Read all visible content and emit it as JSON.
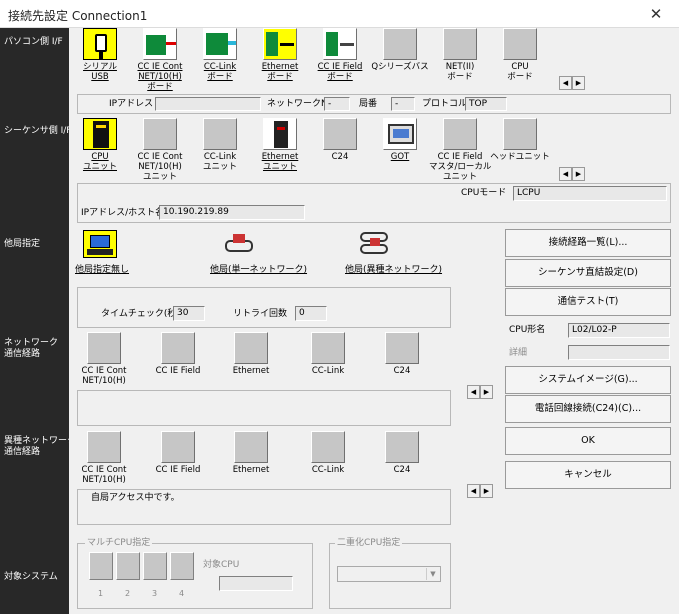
{
  "window": {
    "title": "接続先設定 Connection1",
    "close": "✕"
  },
  "sidebar": {
    "pc_side": "パソコン側 I/F",
    "plc_side": "シーケンサ側 I/F",
    "other_station": "他局指定",
    "network_route_1": "ネットワーク",
    "network_route_2": "通信経路",
    "hetero_route_1": "異種ネットワーク",
    "hetero_route_2": "通信経路",
    "target_system": "対象システム"
  },
  "pc_if": {
    "items": [
      {
        "label1": "シリアル",
        "label2": "USB",
        "label3": ""
      },
      {
        "label1": "CC IE Cont",
        "label2": "NET/10(H)",
        "label3": "ボード"
      },
      {
        "label1": "CC-Link",
        "label2": "ボード",
        "label3": ""
      },
      {
        "label1": "Ethernet",
        "label2": "ボード",
        "label3": ""
      },
      {
        "label1": "CC IE Field",
        "label2": "ボード",
        "label3": ""
      },
      {
        "label1": "Qシリーズバス",
        "label2": "",
        "label3": ""
      },
      {
        "label1": "NET(II)",
        "label2": "ボード",
        "label3": ""
      },
      {
        "label1": "CPU",
        "label2": "ボード",
        "label3": ""
      }
    ],
    "ip_label": "IPアドレス",
    "ip_value": "",
    "network_no_label": "ネットワークNo",
    "network_no_value": "-",
    "station_label": "局番",
    "station_value": "-",
    "protocol_label": "プロトコル",
    "protocol_value": "TOP"
  },
  "plc_if": {
    "items": [
      {
        "label1": "CPU",
        "label2": "ユニット",
        "label3": ""
      },
      {
        "label1": "CC IE Cont",
        "label2": "NET/10(H)",
        "label3": "ユニット"
      },
      {
        "label1": "CC-Link",
        "label2": "ユニット",
        "label3": ""
      },
      {
        "label1": "Ethernet",
        "label2": "ユニット",
        "label3": ""
      },
      {
        "label1": "C24",
        "label2": "",
        "label3": ""
      },
      {
        "label1": "GOT",
        "label2": "",
        "label3": ""
      },
      {
        "label1": "CC IE Field",
        "label2": "マスタ/ローカル",
        "label3": "ユニット"
      },
      {
        "label1": "ヘッドユニット",
        "label2": "",
        "label3": ""
      }
    ],
    "cpu_mode_label": "CPUモード",
    "cpu_mode_value": "LCPU",
    "host_label": "IPアドレス/ホスト名",
    "host_value": "10.190.219.89"
  },
  "other": {
    "no_other": "他局指定無し",
    "single_net": "他局(単一ネットワーク)",
    "multi_net": "他局(異種ネットワーク)",
    "timecheck_label": "タイムチェック(秒)",
    "timecheck_value": "30",
    "retry_label": "リトライ回数",
    "retry_value": "0"
  },
  "route1": {
    "items": [
      {
        "label1": "CC IE Cont",
        "label2": "NET/10(H)"
      },
      {
        "label1": "CC IE Field",
        "label2": ""
      },
      {
        "label1": "Ethernet",
        "label2": ""
      },
      {
        "label1": "CC-Link",
        "label2": ""
      },
      {
        "label1": "C24",
        "label2": ""
      }
    ]
  },
  "route2": {
    "items": [
      {
        "label1": "CC IE Cont",
        "label2": "NET/10(H)"
      },
      {
        "label1": "CC IE Field",
        "label2": ""
      },
      {
        "label1": "Ethernet",
        "label2": ""
      },
      {
        "label1": "CC-Link",
        "label2": ""
      },
      {
        "label1": "C24",
        "label2": ""
      }
    ],
    "status": "自局アクセス中です。"
  },
  "buttons": {
    "route_list": "接続経路一覧(L)...",
    "direct": "シーケンサ直結設定(D)",
    "test": "通信テスト(T)",
    "system_image": "システムイメージ(G)...",
    "phone": "電話回線接続(C24)(C)...",
    "ok": "OK",
    "cancel": "キャンセル"
  },
  "cpu_info": {
    "model_label": "CPU形名",
    "model_value": "L02/L02-P",
    "detail_label": "詳細",
    "detail_value": ""
  },
  "system": {
    "multi_cpu": "マルチCPU指定",
    "target_cpu": "対象CPU",
    "nums": [
      "1",
      "2",
      "3",
      "4"
    ],
    "redundant": "二重化CPU指定"
  },
  "arrows": {
    "left": "◀",
    "right": "▶"
  },
  "colors": {
    "sidebar": "#282828",
    "highlight": "#ffff00",
    "icon": "#c6c6c6"
  }
}
